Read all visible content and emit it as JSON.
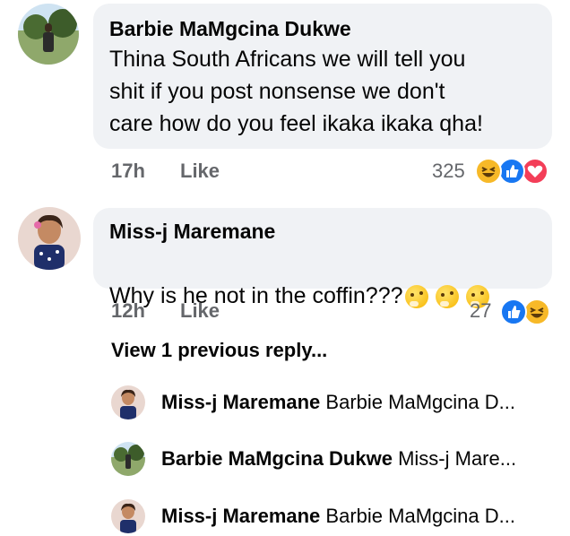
{
  "comments": [
    {
      "author": "Barbie MaMgcina Dukwe",
      "text": "Thina South Africans we will tell you\nshit if you post nonsense we don't\ncare how do you feel ikaka ikaka qha!",
      "time": "17h",
      "like_label": "Like",
      "reaction_count": "325",
      "reactions": [
        "haha-icon",
        "like-icon",
        "love-icon"
      ]
    },
    {
      "author": "Miss-j Maremane",
      "text": "Why is he not in the coffin???",
      "time": "12h",
      "like_label": "Like",
      "reaction_count": "27",
      "reactions": [
        "like-icon",
        "haha-icon"
      ]
    }
  ],
  "view_previous": "View 1 previous reply...",
  "replies": [
    {
      "author": "Miss-j Maremane",
      "snippet": "Barbie MaMgcina D..."
    },
    {
      "author": "Barbie MaMgcina Dukwe",
      "snippet": "Miss-j Mare..."
    },
    {
      "author": "Miss-j Maremane",
      "snippet": "Barbie MaMgcina D..."
    }
  ],
  "colors": {
    "bubble": "#f0f2f5",
    "meta": "#65676b",
    "like_blue": "#1877f2",
    "love_red": "#f33e58",
    "haha_yellow": "#f7b928"
  }
}
